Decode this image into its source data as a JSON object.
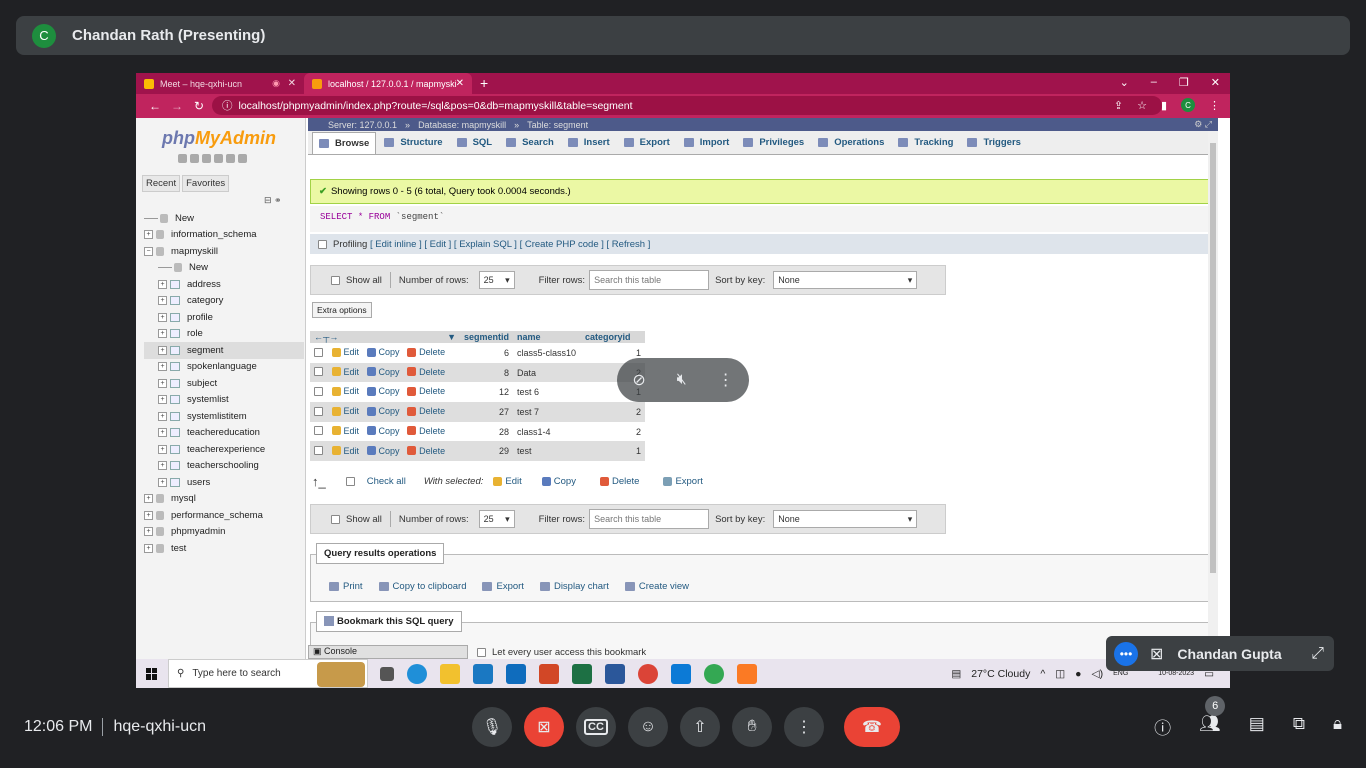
{
  "meet": {
    "presenter_initial": "C",
    "presenter_label": "Chandan Rath (Presenting)",
    "time": "12:06 PM",
    "meeting_code": "hqe-qxhi-ucn",
    "participants_count": "6",
    "self_name": "Chandan Gupta",
    "accent": "#1a73e8",
    "danger": "#ea4335"
  },
  "browser": {
    "tabs": [
      {
        "label": "Meet – hqe-qxhi-ucn"
      },
      {
        "label": "localhost / 127.0.0.1 / mapmyski"
      }
    ],
    "url": "localhost/phpmyadmin/index.php?route=/sql&pos=0&db=mapmyskill&table=segment",
    "profile_initial": "C",
    "theme_color": "#c0245e"
  },
  "pma": {
    "logo_php": "php",
    "logo_admin": "MyAdmin",
    "nav_tabs": [
      "Recent",
      "Favorites"
    ],
    "tree": [
      {
        "label": "New",
        "kind": "new",
        "level": 0
      },
      {
        "label": "information_schema",
        "kind": "db",
        "level": 0
      },
      {
        "label": "mapmyskill",
        "kind": "db",
        "level": 0
      },
      {
        "label": "New",
        "kind": "new",
        "level": 1
      },
      {
        "label": "address",
        "kind": "table",
        "level": 1
      },
      {
        "label": "category",
        "kind": "table",
        "level": 1
      },
      {
        "label": "profile",
        "kind": "table",
        "level": 1
      },
      {
        "label": "role",
        "kind": "table",
        "level": 1
      },
      {
        "label": "segment",
        "kind": "table",
        "level": 1,
        "selected": true
      },
      {
        "label": "spokenlanguage",
        "kind": "table",
        "level": 1
      },
      {
        "label": "subject",
        "kind": "table",
        "level": 1
      },
      {
        "label": "systemlist",
        "kind": "table",
        "level": 1
      },
      {
        "label": "systemlistitem",
        "kind": "table",
        "level": 1
      },
      {
        "label": "teachereducation",
        "kind": "table",
        "level": 1
      },
      {
        "label": "teacherexperience",
        "kind": "table",
        "level": 1
      },
      {
        "label": "teacherschooling",
        "kind": "table",
        "level": 1
      },
      {
        "label": "users",
        "kind": "table",
        "level": 1
      },
      {
        "label": "mysql",
        "kind": "db",
        "level": 0
      },
      {
        "label": "performance_schema",
        "kind": "db",
        "level": 0
      },
      {
        "label": "phpmyadmin",
        "kind": "db",
        "level": 0
      },
      {
        "label": "test",
        "kind": "db",
        "level": 0
      }
    ],
    "breadcrumb": {
      "server": "Server: 127.0.0.1",
      "database": "Database: mapmyskill",
      "table": "Table: segment"
    },
    "tabs": [
      "Browse",
      "Structure",
      "SQL",
      "Search",
      "Insert",
      "Export",
      "Import",
      "Privileges",
      "Operations",
      "Tracking",
      "Triggers"
    ],
    "success_msg": "Showing rows 0 - 5 (6 total, Query took 0.0004 seconds.)",
    "sql_select": "SELECT",
    "sql_star": "*",
    "sql_from": "FROM",
    "sql_table": "`segment`",
    "profiling": "Profiling",
    "profiling_links": "[ Edit inline ] [ Edit ] [ Explain SQL ] [ Create PHP code ] [ Refresh ]",
    "nav": {
      "show_all": "Show all",
      "rows_label": "Number of rows:",
      "rows_value": "25",
      "filter_label": "Filter rows:",
      "filter_placeholder": "Search this table",
      "sort_label": "Sort by key:",
      "sort_value": "None"
    },
    "extra_options": "Extra options",
    "columns": [
      "segmentid",
      "name",
      "categoryid"
    ],
    "row_actions": {
      "edit": "Edit",
      "copy": "Copy",
      "delete": "Delete"
    },
    "rows": [
      {
        "segmentid": "6",
        "name": "class5-class10",
        "categoryid": "1"
      },
      {
        "segmentid": "8",
        "name": "Data",
        "categoryid": "2"
      },
      {
        "segmentid": "12",
        "name": "test 6",
        "categoryid": "1"
      },
      {
        "segmentid": "27",
        "name": "test 7",
        "categoryid": "2"
      },
      {
        "segmentid": "28",
        "name": "class1-4",
        "categoryid": "2"
      },
      {
        "segmentid": "29",
        "name": "test",
        "categoryid": "1"
      }
    ],
    "check_all": "Check all",
    "with_selected": "With selected:",
    "bulk": {
      "edit": "Edit",
      "copy": "Copy",
      "delete": "Delete",
      "export": "Export"
    },
    "qro_title": "Query results operations",
    "qro_links": [
      "Print",
      "Copy to clipboard",
      "Export",
      "Display chart",
      "Create view"
    ],
    "bookmark_title": "Bookmark this SQL query",
    "bookmark_option": "Let every user access this bookmark",
    "console": "Console"
  },
  "taskbar": {
    "search_placeholder": "Type here to search",
    "weather": "27°C  Cloudy",
    "lang": "ENG",
    "date": "10-08-2023"
  }
}
